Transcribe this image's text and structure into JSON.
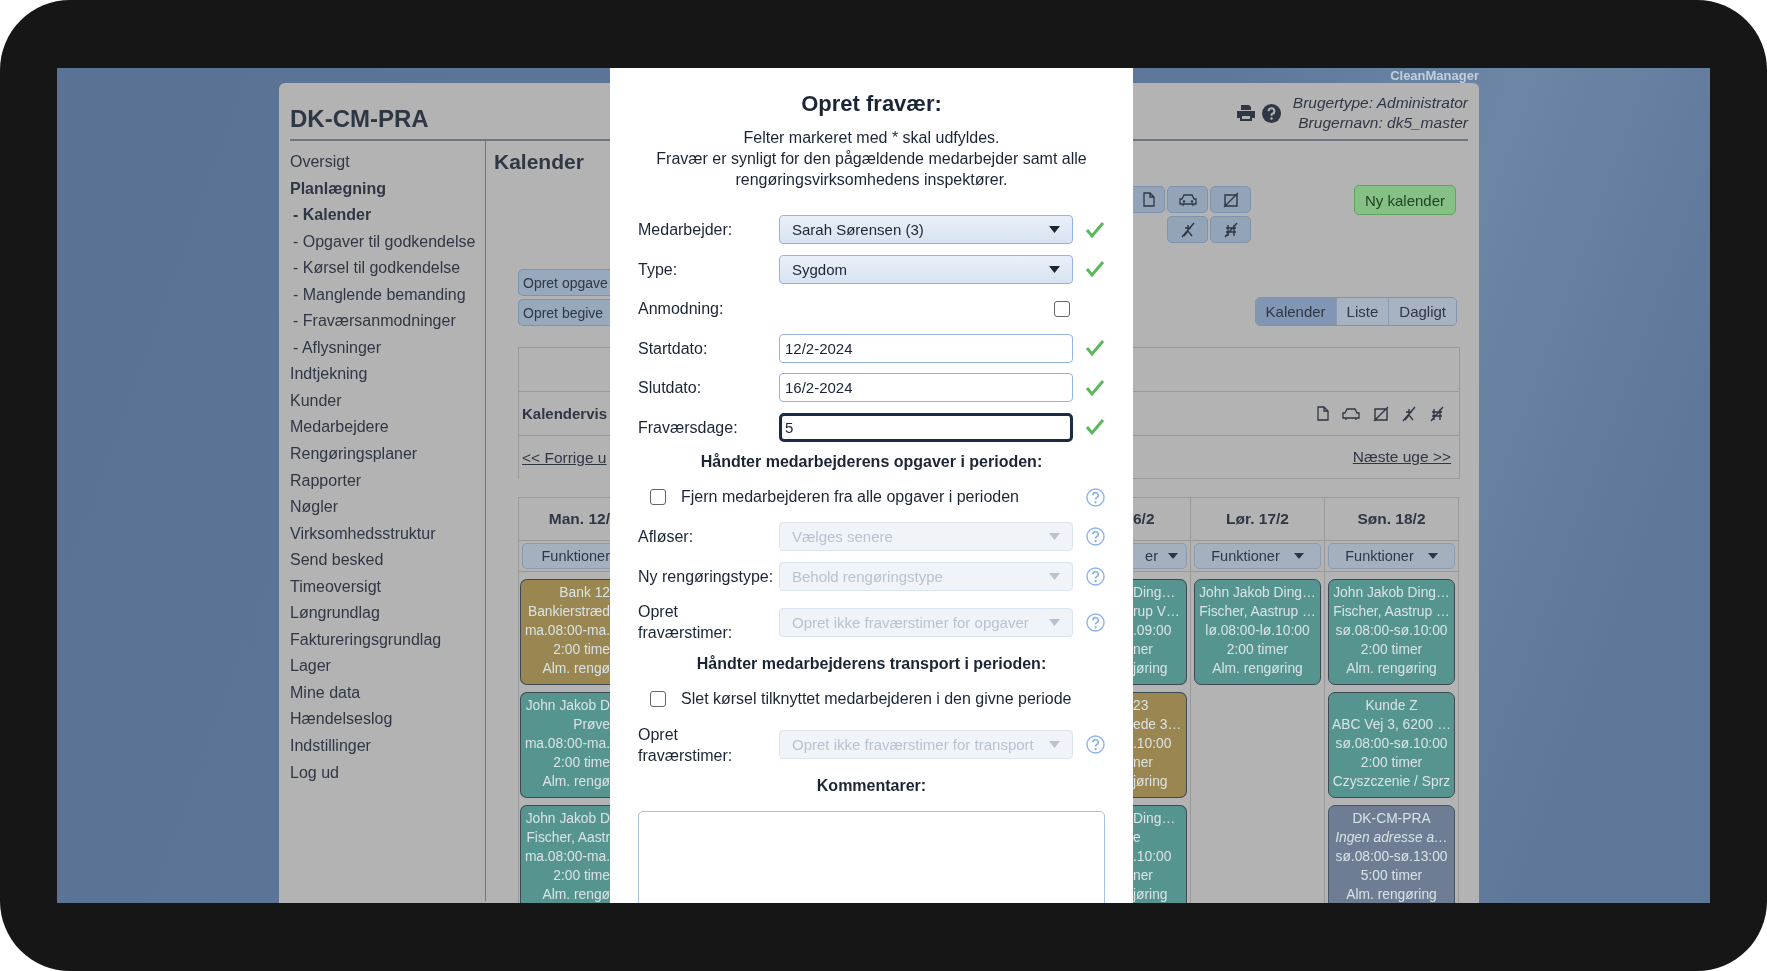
{
  "brand": "CleanManager",
  "app": {
    "title": "DK-CM-PRA",
    "user_type": "Brugertype: Administrator",
    "user_name": "Brugernavn: dk5_master"
  },
  "sidebar": {
    "items": [
      {
        "label": "Oversigt",
        "selected": false
      },
      {
        "label": "Planlægning",
        "selected": true,
        "children": [
          {
            "label": "- Kalender",
            "selected": true
          },
          {
            "label": "- Opgaver til godkendelse",
            "selected": false
          },
          {
            "label": "- Kørsel til godkendelse",
            "selected": false
          },
          {
            "label": "- Manglende bemanding",
            "selected": false
          },
          {
            "label": "- Fraværsanmodninger",
            "selected": false
          },
          {
            "label": "- Aflysninger",
            "selected": false
          }
        ]
      },
      {
        "label": "Indtjekning",
        "selected": false
      },
      {
        "label": "Kunder",
        "selected": false
      },
      {
        "label": "Medarbejdere",
        "selected": false
      },
      {
        "label": "Rengøringsplaner",
        "selected": false
      },
      {
        "label": "Rapporter",
        "selected": false
      },
      {
        "label": "Nøgler",
        "selected": false
      },
      {
        "label": "Virksomhedsstruktur",
        "selected": false
      },
      {
        "label": "Send besked",
        "selected": false
      },
      {
        "label": "Timeoversigt",
        "selected": false
      },
      {
        "label": "Løngrundlag",
        "selected": false
      },
      {
        "label": "Faktureringsgrundlag",
        "selected": false
      },
      {
        "label": "Lager",
        "selected": false
      },
      {
        "label": "Mine data",
        "selected": false
      },
      {
        "label": "Hændelseslog",
        "selected": false
      },
      {
        "label": "Indstillinger",
        "selected": false
      },
      {
        "label": "Log ud",
        "selected": false
      }
    ]
  },
  "page_title": "Kalender",
  "actions": [
    "Opret opgave",
    "Opret begive"
  ],
  "new_calendar_button": "Ny kalender",
  "view_tabs": [
    {
      "label": "Kalender",
      "selected": true
    },
    {
      "label": "Liste",
      "selected": false
    },
    {
      "label": "Dagligt",
      "selected": false
    }
  ],
  "calendar_view_label": "Kalendervis",
  "prev_link": "<< Forrige u",
  "next_link": "Næste uge >>",
  "calendar": {
    "columns_left": [
      {
        "header": "Man. 12/",
        "menu": "Funktioner",
        "cards": [
          {
            "kind": "task",
            "color": "#9a8651",
            "lines": [
              "Bank 12",
              "Bankierstræd",
              "ma.08:00-ma.",
              "2:00 time",
              "Alm. rengø"
            ]
          },
          {
            "kind": "task",
            "color": "#56958f",
            "lines": [
              "John Jakob D",
              "Prøve",
              "ma.08:00-ma.",
              "2:00 time",
              "Alm. rengø"
            ]
          },
          {
            "kind": "task",
            "color": "#56958f",
            "lines": [
              "John Jakob D",
              "Fischer, Aastr",
              "ma.08:00-ma.",
              "2:00 time",
              "Alm. rengø"
            ]
          }
        ]
      }
    ],
    "columns_right": [
      {
        "header": "6/2",
        "menu": "er",
        "cards": [
          {
            "kind": "task",
            "color": "#56958f",
            "lines": [
              "Ding…",
              "rup V…",
              ".09:00",
              "ner",
              "jøring"
            ]
          },
          {
            "kind": "task",
            "color": "#9a8651",
            "lines": [
              "23",
              "ede 3…",
              ".10:00",
              "ner",
              "jøring"
            ]
          },
          {
            "kind": "task",
            "color": "#56958f",
            "lines": [
              "Ding…",
              "e",
              ".10:00",
              "ner",
              "jøring"
            ]
          }
        ]
      },
      {
        "header": "Lør. 17/2",
        "menu": "Funktioner",
        "cards": [
          {
            "kind": "task",
            "color": "#56958f",
            "lines": [
              "John Jakob Ding…",
              "Fischer, Aastrup …",
              "lø.08:00-lø.10:00",
              "2:00 timer",
              "Alm. rengøring"
            ]
          }
        ]
      },
      {
        "header": "Søn. 18/2",
        "menu": "Funktioner",
        "cards": [
          {
            "kind": "task",
            "color": "#56958f",
            "lines": [
              "John Jakob Ding…",
              "Fischer, Aastrup …",
              "sø.08:00-sø.10:00",
              "2:00 timer",
              "Alm. rengøring"
            ]
          },
          {
            "kind": "task",
            "color": "#56958f",
            "lines": [
              "Kunde Z",
              "ABC Vej 3, 6200 …",
              "sø.08:00-sø.10:00",
              "2:00 timer",
              "Czyszczenie / Sprz"
            ]
          },
          {
            "kind": "event",
            "color": "#6e7d94",
            "lines": [
              "DK-CM-PRA",
              "Ingen adresse a…",
              "sø.08:00-sø.13:00",
              "5:00 timer",
              "Alm. rengøring"
            ]
          }
        ]
      }
    ]
  },
  "dialog": {
    "title": "Opret fravær:",
    "intro": [
      "Felter markeret med * skal udfyldes.",
      "Fravær er synligt for den pågældende medarbejder samt alle rengøringsvirksomhedens inspektører."
    ],
    "rows": [
      {
        "kind": "select",
        "label": "Medarbejder:",
        "value": "Sarah Sørensen (3)",
        "disabled": false,
        "valid": true,
        "help": false
      },
      {
        "kind": "select",
        "label": "Type:",
        "value": "Sygdom",
        "disabled": false,
        "valid": true,
        "help": false
      },
      {
        "kind": "checkbox",
        "label": "Anmodning:",
        "checked": false
      },
      {
        "kind": "input",
        "label": "Startdato:",
        "value": "12/2-2024",
        "focused": false,
        "valid": true
      },
      {
        "kind": "input",
        "label": "Slutdato:",
        "value": "16/2-2024",
        "focused": false,
        "valid": true
      },
      {
        "kind": "input",
        "label": "Fraværsdage:",
        "value": "5",
        "focused": true,
        "valid": true
      },
      {
        "kind": "heading",
        "label": "Håndter medarbejderens opgaver i perioden:"
      },
      {
        "kind": "option",
        "label": "Fjern medarbejderen fra alle opgaver i perioden",
        "checked": false,
        "help": true
      },
      {
        "kind": "select",
        "label": "Afløser:",
        "value": "Vælges senere",
        "disabled": true,
        "valid": false,
        "help": true
      },
      {
        "kind": "select",
        "label": "Ny rengøringstype:",
        "value": "Behold rengøringstype",
        "disabled": true,
        "valid": false,
        "help": true
      },
      {
        "kind": "select",
        "label": "Opret fraværstimer:",
        "value": "Opret ikke fraværstimer for opgaver",
        "disabled": true,
        "valid": false,
        "help": true
      },
      {
        "kind": "heading",
        "label": "Håndter medarbejderens transport i perioden:"
      },
      {
        "kind": "option",
        "label": "Slet kørsel tilknyttet medarbejderen i den givne periode",
        "checked": false,
        "help": false
      },
      {
        "kind": "select",
        "label": "Opret fraværstimer:",
        "value": "Opret ikke fraværstimer for transport",
        "disabled": true,
        "valid": false,
        "help": true
      },
      {
        "kind": "heading",
        "label": "Kommentarer:"
      }
    ]
  }
}
